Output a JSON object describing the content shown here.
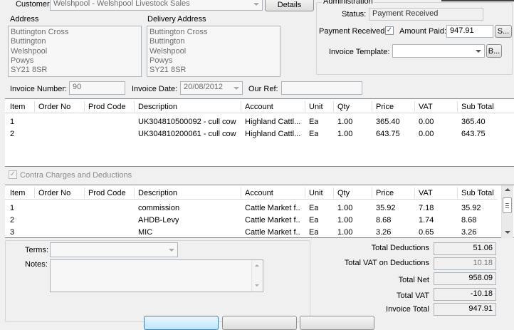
{
  "header": {
    "customer_label": "Customer:",
    "customer_value": "Welshpool - Welshpool Livestock Sales",
    "details_button": "Details",
    "address_label": "Address",
    "address_lines": [
      "Buttington Cross",
      "Buttington",
      "Welshpool",
      "Powys",
      "SY21 8SR"
    ],
    "delivery_label": "Delivery Address",
    "delivery_lines": [
      "Buttington Cross",
      "Buttington",
      "Welshpool",
      "Powys",
      "SY21 8SR"
    ]
  },
  "admin": {
    "group_title": "Administration",
    "status_label": "Status:",
    "status_value": "Payment Received",
    "payment_received_label": "Payment Received",
    "payment_received_checked": true,
    "amount_paid_label": "Amount Paid:",
    "amount_paid_value": "947.91",
    "amount_btn": "S...",
    "invoice_template_label": "Invoice Template:",
    "invoice_template_value": "",
    "template_btn": "B..."
  },
  "invoice_row": {
    "number_label": "Invoice Number:",
    "number_value": "90",
    "date_label": "Invoice Date:",
    "date_value": "20/08/2012",
    "ourref_label": "Our Ref:",
    "ourref_value": ""
  },
  "columns": [
    "Item",
    "Order No",
    "Prod Code",
    "Description",
    "Account",
    "Unit",
    "Qty",
    "Price",
    "VAT",
    "Sub Total"
  ],
  "items": [
    {
      "item": "1",
      "order": "",
      "prod": "",
      "desc": "UK304810500092 - cull cow",
      "account": "Highland Cattl...",
      "unit": "Ea",
      "qty": "1.00",
      "price": "365.40",
      "vat": "0.00",
      "subtotal": "365.40"
    },
    {
      "item": "2",
      "order": "",
      "prod": "",
      "desc": "UK304810200061 - cull cow",
      "account": "Highland Cattl...",
      "unit": "Ea",
      "qty": "1.00",
      "price": "643.75",
      "vat": "0.00",
      "subtotal": "643.75"
    }
  ],
  "contra": {
    "checkbox_label": "Contra Charges and Deductions",
    "checked": true,
    "rows": [
      {
        "item": "1",
        "order": "",
        "prod": "",
        "desc": "commission",
        "account": "Cattle Market f...",
        "unit": "Ea",
        "qty": "1.00",
        "price": "35.92",
        "vat": "7.18",
        "subtotal": "35.92"
      },
      {
        "item": "2",
        "order": "",
        "prod": "",
        "desc": "AHDB-Levy",
        "account": "Cattle Market f...",
        "unit": "Ea",
        "qty": "1.00",
        "price": "8.68",
        "vat": "1.74",
        "subtotal": "8.68"
      },
      {
        "item": "3",
        "order": "",
        "prod": "",
        "desc": "MIC",
        "account": "Cattle Market f...",
        "unit": "Ea",
        "qty": "1.00",
        "price": "3.26",
        "vat": "0.65",
        "subtotal": "3.26"
      }
    ]
  },
  "footer": {
    "terms_label": "Terms:",
    "terms_value": "",
    "notes_label": "Notes:",
    "notes_value": ""
  },
  "totals": {
    "deductions_label": "Total Deductions",
    "deductions_value": "51.06",
    "vat_deductions_label": "Total VAT on Deductions",
    "vat_deductions_value": "10.18",
    "net_label": "Total Net",
    "net_value": "958.09",
    "vat_label": "Total VAT",
    "vat_value": "-10.18",
    "invoice_label": "Invoice Total",
    "invoice_value": "947.91"
  }
}
